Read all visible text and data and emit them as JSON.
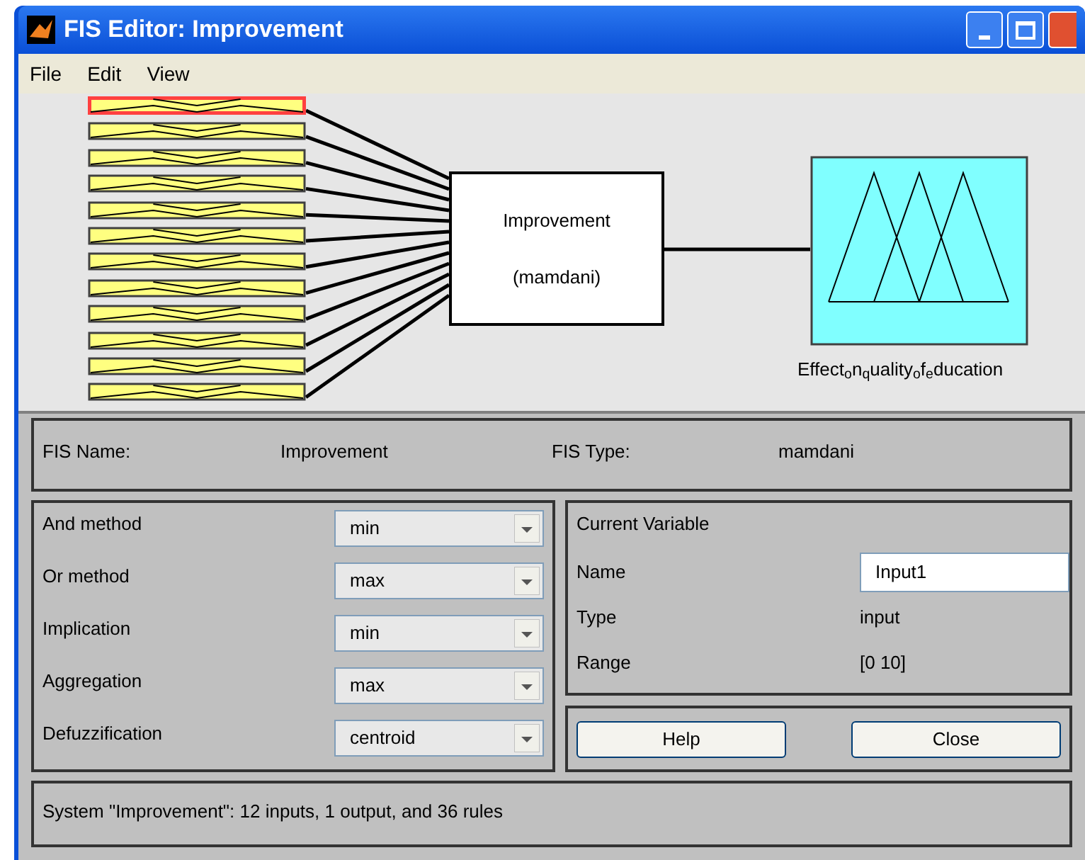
{
  "window": {
    "title": "FIS Editor: Improvement"
  },
  "menu": [
    "File",
    "Edit",
    "View"
  ],
  "inputs": [
    {
      "selected": true
    },
    {
      "selected": false
    },
    {
      "selected": false
    },
    {
      "selected": false
    },
    {
      "selected": false
    },
    {
      "selected": false
    },
    {
      "selected": false
    },
    {
      "selected": false
    },
    {
      "selected": false
    },
    {
      "selected": false
    },
    {
      "selected": false
    },
    {
      "selected": false
    }
  ],
  "system_box": {
    "name": "Improvement",
    "type": "(mamdani)"
  },
  "output": {
    "label": "Effect$_{o}$n$_{q}$uality$_{o}$f$_{e}$ducation",
    "selected": false
  },
  "fis_info": [
    {
      "label": "FIS Name:",
      "value": "Improvement"
    },
    {
      "label": "FIS Type:",
      "value": "mamdani"
    }
  ],
  "methods": [
    {
      "label": "And method",
      "value": "min"
    },
    {
      "label": "Or method",
      "value": "max"
    },
    {
      "label": "Implication",
      "value": "min"
    },
    {
      "label": "Aggregation",
      "value": "max"
    },
    {
      "label": "Defuzzification",
      "value": "centroid"
    }
  ],
  "current_variable": {
    "title": "Current Variable",
    "rows": [
      {
        "label": "Name",
        "value": "Input1",
        "kind": "field"
      },
      {
        "label": "Type",
        "value": "input",
        "kind": "text"
      },
      {
        "label": "Range",
        "value": "[0 10]",
        "kind": "text"
      }
    ]
  },
  "buttons": [
    "Help",
    "Close"
  ],
  "status_bar": "System \"Improvement\": 12 inputs, 1 output, and 36 rules"
}
